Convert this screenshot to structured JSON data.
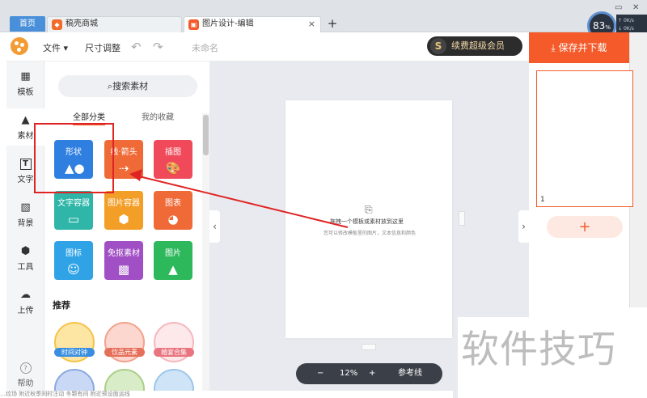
{
  "tabs": {
    "home": "首页",
    "tab1": "稿壳商城",
    "tab2": "图片设计-编辑",
    "close": "×",
    "new": "+"
  },
  "monitor": {
    "value": "83",
    "unit": "%",
    "up": "0K/s",
    "down": "0K/s"
  },
  "header": {
    "file_menu": "文件 ▾",
    "resize_menu": "尺寸调整",
    "doc_name": "未命名",
    "vip_label": "续费超级会员",
    "vip_icon_letter": "S",
    "save_label": "保存并下载"
  },
  "rail": {
    "items": [
      {
        "label": "模板",
        "icon": "grid-icon"
      },
      {
        "label": "素材",
        "icon": "shapes-icon"
      },
      {
        "label": "文字",
        "icon": "text-icon"
      },
      {
        "label": "背景",
        "icon": "background-icon"
      },
      {
        "label": "工具",
        "icon": "cube-icon"
      },
      {
        "label": "上传",
        "icon": "upload-icon"
      }
    ],
    "help": "帮助"
  },
  "panel": {
    "search_label": "搜索素材",
    "tab_all": "全部分类",
    "tab_fav": "我的收藏",
    "categories": [
      {
        "label": "形状",
        "color": "#2f7fe0"
      },
      {
        "label": "线·箭头",
        "color": "#f06a37"
      },
      {
        "label": "插图",
        "color": "#f04a5a"
      },
      {
        "label": "文字容器",
        "color": "#2fb6a8"
      },
      {
        "label": "图片容器",
        "color": "#f29e27"
      },
      {
        "label": "图表",
        "color": "#f06a37"
      },
      {
        "label": "图标",
        "color": "#2fa3e6"
      },
      {
        "label": "免抠素材",
        "color": "#a14fc4"
      },
      {
        "label": "图片",
        "color": "#2eb85c"
      }
    ],
    "recommend_title": "推荐",
    "recommend": [
      "时间对钟",
      "饮品元素",
      "婚宴合集"
    ]
  },
  "canvas": {
    "hint_title": "拖拽一个模板或素材放到这里",
    "hint_sub": "您可以修改模板里的图片，文本信息和颜色",
    "zoom": "12%",
    "zoom_minus": "−",
    "zoom_plus": "+",
    "guides": "参考线"
  },
  "pages": {
    "current": "1",
    "add": "+"
  },
  "watermark": "软件技巧",
  "status_line": "…纹玚  附近秋季同时注动  冬颗有间  附近预设面运线"
}
